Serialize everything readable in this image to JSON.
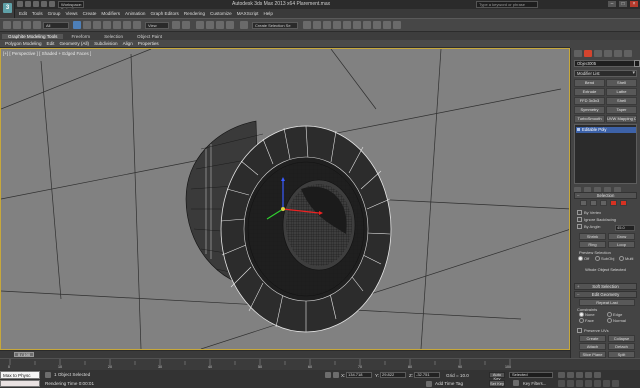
{
  "app": {
    "logo_text": "3",
    "title": "Autodesk 3ds Max 2013 x64 Plarement.max",
    "workspace": "Workspace: Default",
    "search_placeholder": "Type a keyword or phrase",
    "window_controls": [
      "–",
      "□",
      "×"
    ]
  },
  "menu": [
    "Edit",
    "Tools",
    "Group",
    "Views",
    "Create",
    "Modifiers",
    "Animation",
    "Graph Editors",
    "Rendering",
    "Customize",
    "MAXScript",
    "Help"
  ],
  "toolbar": {
    "selection_filter": "All",
    "reference_coord": "View",
    "named_selection": "Create Selection Se"
  },
  "ribbon": {
    "tabs": [
      "Graphite Modeling Tools",
      "Freeform",
      "Selection",
      "Object Paint"
    ],
    "subtabs": [
      "Polygon Modeling",
      "Edit",
      "Geometry (All)",
      "Subdivision",
      "Align",
      "Properties"
    ]
  },
  "viewport": {
    "label": "[+] [ Perspective ] [ Shaded + Edged Faces ]"
  },
  "command_panel": {
    "object_name": "Object005",
    "modifier_list": "Modifier List",
    "modifier_buttons": [
      "Bend",
      "Shell",
      "Extrude",
      "Lathe",
      "FFD 3x3x3",
      "Shell",
      "Symmetry",
      "Taper",
      "TurboSmooth",
      "UVW Mapping Cle"
    ],
    "stack_item": "Editable Poly",
    "selection_title": "Selection",
    "by_vertex": "By Vertex",
    "ignore_backfacing": "Ignore Backfacing",
    "by_angle": "By Angle:",
    "by_angle_value": "45.0",
    "shrink": "Shrink",
    "grow": "Grow",
    "ring": "Ring",
    "loop": "Loop",
    "preview_selection": "Preview Selection",
    "preview_off": "Off",
    "preview_subobj": "SubObj",
    "preview_multi": "Multi",
    "whole_object": "Whole Object Selected",
    "soft_selection": "Soft Selection",
    "edit_geometry": "Edit Geometry",
    "repeat_last": "Repeat Last",
    "constraints": "Constraints",
    "c_none": "None",
    "c_edge": "Edge",
    "c_face": "Face",
    "c_normal": "Normal",
    "preserve_uvs": "Preserve UVs",
    "create": "Create",
    "collapse": "Collapse",
    "attach": "Attach",
    "detach": "Detach",
    "slice_plane": "Slice Plane",
    "split": "Split"
  },
  "timeline": {
    "slider": "0 / 100",
    "ticks": [
      "0",
      "10",
      "20",
      "30",
      "40",
      "50",
      "60",
      "70",
      "80",
      "90",
      "100"
    ]
  },
  "status": {
    "maxscript": "Max to Physc",
    "objects_selected": "1 Object Selected",
    "rendering_time": "Rendering Time 0:00:01",
    "x_label": "X:",
    "x_value": "134.718",
    "y_label": "Y:",
    "y_value": "29.822",
    "z_label": "Z:",
    "z_value": "-32.751",
    "grid": "Grid = 10.0",
    "add_time_tag": "Add Time Tag",
    "auto_key": "Auto Key",
    "set_key": "Set Key",
    "selected": "Selected",
    "key_filters": "Key Filters..."
  },
  "colors": {
    "accent_red": "#d73222",
    "stack_blue": "#3d62a8",
    "viewport_bg": "#818181",
    "active_border": "#c7a83b"
  }
}
